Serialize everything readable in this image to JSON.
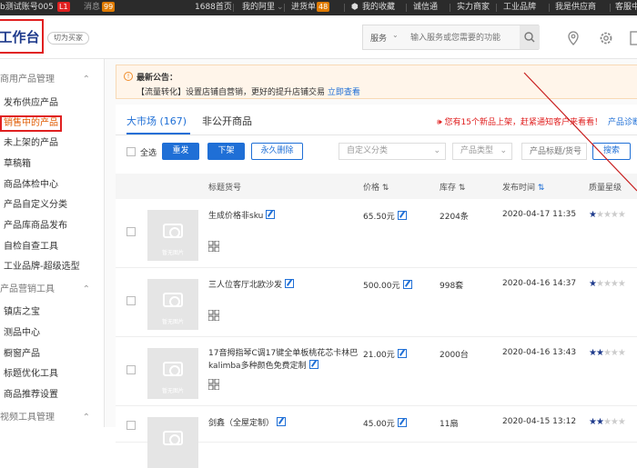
{
  "topbar": {
    "account": "b测试账号005",
    "level_badge": "L1",
    "messages_label": "消息",
    "messages_count": "99",
    "home": "1688首页",
    "my_ali": "我的阿里",
    "purchase": "进货单",
    "purchase_count": "48",
    "favorites": "我的收藏",
    "trust": "诚信通",
    "strength": "实力商家",
    "industrial": "工业品牌",
    "supplier": "我是供应商",
    "service": "客服中"
  },
  "header": {
    "workbench": "工作台",
    "switch_label": "切为买家",
    "search_scope": "服务",
    "search_placeholder": "输入服务或您需要的功能"
  },
  "sidebar": {
    "section1": "商用产品管理",
    "items1": [
      "发布供应产品",
      "销售中的产品",
      "未上架的产品",
      "草稿箱",
      "商品体检中心",
      "产品自定义分类",
      "产品库商品发布",
      "自检自查工具",
      "工业品牌-超级选型"
    ],
    "section2": "产品营销工具",
    "items2": [
      "镇店之宝",
      "测品中心",
      "橱窗产品",
      "标题优化工具",
      "商品推荐设置"
    ],
    "section3": "视频工具管理"
  },
  "notice": {
    "title": "最新公告：",
    "text": "【流量转化】设置店铺自营销，更好的提升店铺交易",
    "link": "立即查看"
  },
  "tabs": {
    "market": "大市场 (167)",
    "private": "非公开商品",
    "promo": "您有15个新品上架，赶紧通知客户来看看！",
    "diagnose": "产品诊断"
  },
  "toolbar": {
    "select_all": "全选",
    "republish": "重发",
    "delist": "下架",
    "delete": "永久删除",
    "custom_category": "自定义分类",
    "product_type": "产品类型",
    "search_placeholder": "产品标题/货号",
    "search_btn": "搜索"
  },
  "table": {
    "headers": {
      "title": "标题货号",
      "price": "价格",
      "stock": "库存",
      "time": "发布时间",
      "quality": "质量星级"
    },
    "thumb_label": "暂无图片",
    "rows": [
      {
        "title": "生成价格非sku",
        "price": "65.50元",
        "stock": "2204条",
        "time": "2020-04-17 11:35",
        "stars": 1
      },
      {
        "title": "三人位客厅北欧沙发",
        "price": "500.00元",
        "stock": "998套",
        "time": "2020-04-16 14:37",
        "stars": 1
      },
      {
        "title": "17音拇指琴C调17键全单板桃花芯卡林巴kalimba多种颜色免费定制",
        "price": "21.00元",
        "stock": "2000台",
        "time": "2020-04-16 13:43",
        "stars": 2
      },
      {
        "title": "剑鑫（全屋定制）",
        "price": "45.00元",
        "stock": "11扇",
        "time": "2020-04-15 13:12",
        "stars": 2
      }
    ]
  }
}
